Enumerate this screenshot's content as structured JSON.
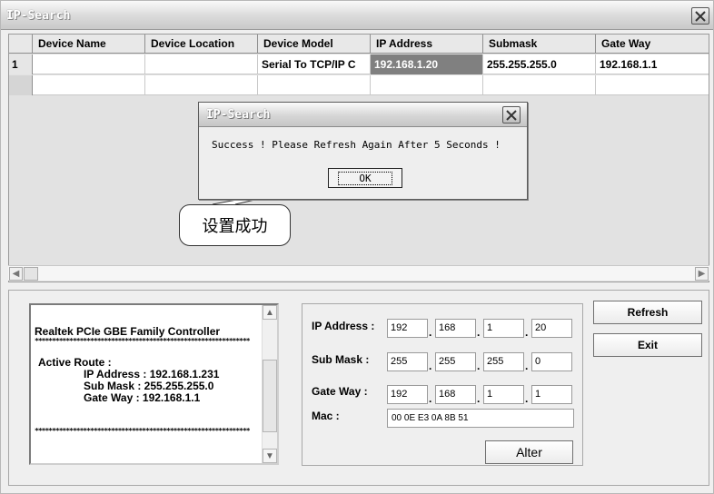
{
  "window": {
    "title": "IP-Search"
  },
  "grid": {
    "columns": [
      "Device Name",
      "Device Location",
      "Device Model",
      "IP Address",
      "Submask",
      "Gate Way"
    ],
    "rows": [
      {
        "index": "1",
        "cells": [
          "",
          "",
          "Serial To TCP/IP C",
          "192.168.1.20",
          "255.255.255.0",
          "192.168.1.1"
        ]
      }
    ]
  },
  "dialog": {
    "title": "IP-Search",
    "message": "Success ! Please Refresh Again After 5 Seconds !",
    "ok_label": "OK"
  },
  "callout": {
    "text": "设置成功"
  },
  "info": {
    "adapter": "Realtek PCIe GBE Family Controller",
    "route_heading": "Active Route :",
    "ip_line": "IP Address : 192.168.1.231",
    "mask_line": "Sub Mask : 255.255.255.0",
    "gw_line": "Gate Way : 192.168.1.1",
    "separator": "**************************************************************"
  },
  "config": {
    "ip_label": "IP Address :",
    "mask_label": "Sub Mask :",
    "gw_label": "Gate Way :",
    "mac_label": "Mac :",
    "ip": [
      "192",
      "168",
      "1",
      "20"
    ],
    "mask": [
      "255",
      "255",
      "255",
      "0"
    ],
    "gw": [
      "192",
      "168",
      "1",
      "1"
    ],
    "mac": "00 0E E3 0A 8B 51",
    "alter_label": "Alter"
  },
  "buttons": {
    "refresh": "Refresh",
    "exit": "Exit"
  }
}
